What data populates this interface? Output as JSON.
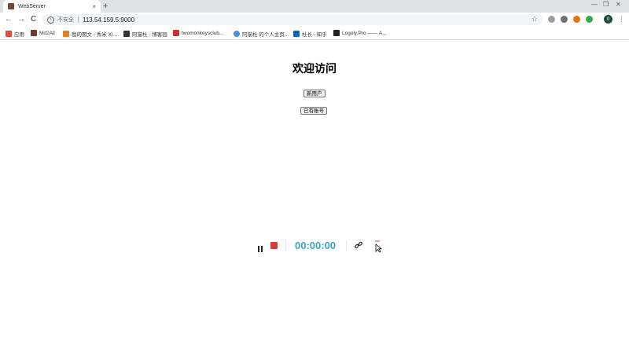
{
  "tab": {
    "title": "WebServer",
    "close": "×",
    "new_tab": "+"
  },
  "window_controls": {
    "minimize": "—",
    "restore": "❐",
    "close": "✕"
  },
  "nav": {
    "back": "←",
    "forward": "→",
    "reload": "C"
  },
  "omnibox": {
    "security_label": "不安全",
    "url": "113.54.159.5:9000",
    "star": "☆"
  },
  "profile": {
    "initial": "0"
  },
  "bookmarks": [
    {
      "label": "应用",
      "color": "#e04b3c"
    },
    {
      "label": "Md2All",
      "color": "#6b3a2a"
    },
    {
      "label": "我的图文 - 秀米 XI...",
      "color": "#e67e22"
    },
    {
      "label": "阿猫杜 - 博客园",
      "color": "#333333"
    },
    {
      "label": "twomonkeysclub...",
      "color": "#d32f2f"
    },
    {
      "label": "阿猫杜 的个人主页...",
      "color": "#4a90d9"
    },
    {
      "label": "杜长 - 知乎",
      "color": "#0a66c2"
    },
    {
      "label": "Logoly.Pro —— A...",
      "color": "#222222"
    }
  ],
  "page": {
    "title": "欢迎访问",
    "new_user_button": "新用户",
    "existing_account_button": "已有账号"
  },
  "recorder": {
    "timer": "00:00:00",
    "accent": "#3aa6b9",
    "stop_color": "#d23f3f"
  }
}
